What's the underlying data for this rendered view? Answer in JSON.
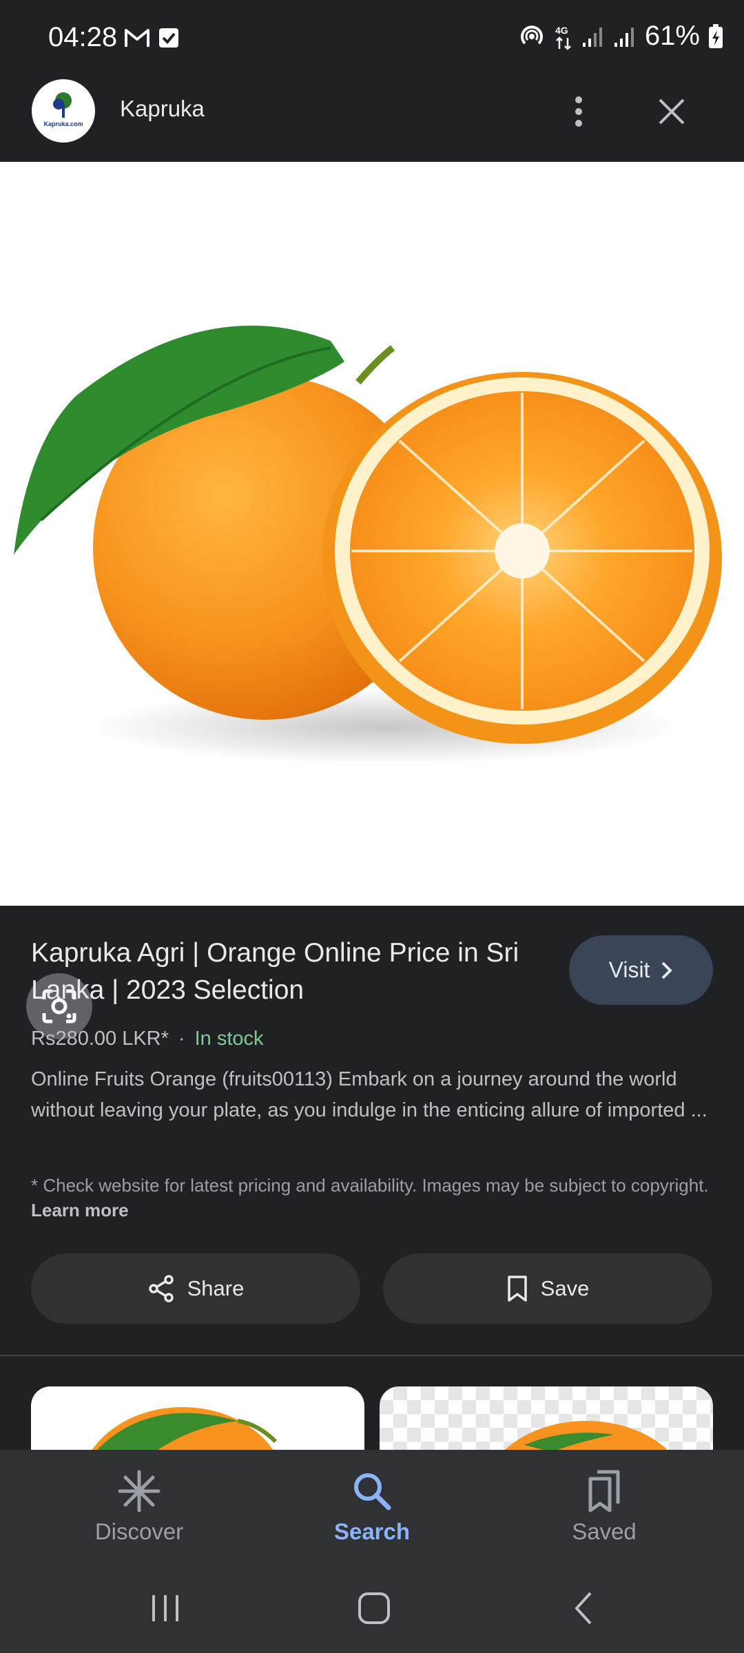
{
  "status_bar": {
    "time": "04:28",
    "battery": "61%",
    "network": "4G"
  },
  "app_bar": {
    "site_name": "Kapruka",
    "logo_text": "Kapruka.com"
  },
  "product": {
    "title": "Kapruka Agri | Orange Online Price in Sri Lanka | 2023 Selection",
    "visit_label": "Visit",
    "price": "Rs280.00 LKR*",
    "separator": "·",
    "stock": "In stock",
    "description": "Online Fruits Orange (fruits00113) Embark on a journey around the world without leaving your plate, as you indulge in the enticing allure of imported ...",
    "note": "* Check website for latest pricing and availability. Images may be subject to copyright.",
    "learn_more": "Learn more"
  },
  "actions": {
    "share_label": "Share",
    "save_label": "Save"
  },
  "bottom_nav": {
    "items": [
      {
        "label": "Discover",
        "icon": "discover-asterisk-icon"
      },
      {
        "label": "Search",
        "icon": "search-icon",
        "active": true
      },
      {
        "label": "Saved",
        "icon": "saved-bookmarks-icon"
      }
    ]
  },
  "colors": {
    "background": "#202124",
    "accent": "#8ab4f8",
    "stock_green": "#81c995",
    "visit_button": "#394457"
  }
}
